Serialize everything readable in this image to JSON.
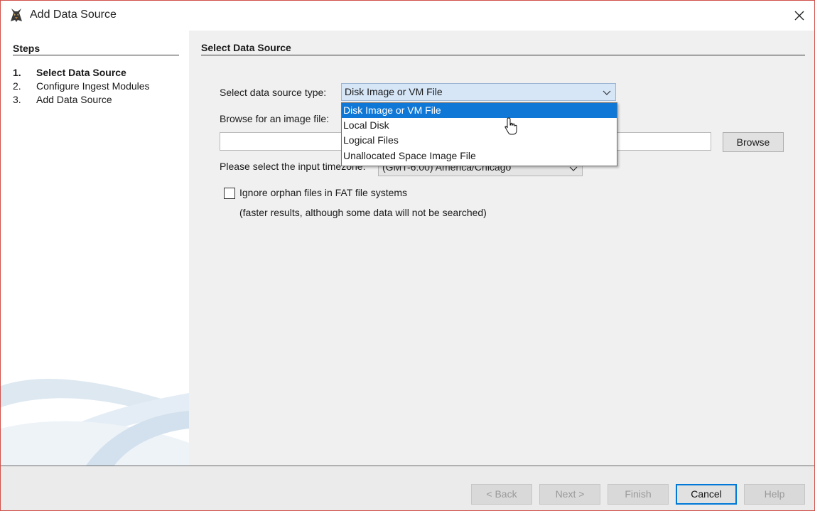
{
  "window": {
    "title": "Add Data Source",
    "icons": {
      "app": "autopsy-dog-icon",
      "close": "close-icon"
    }
  },
  "steps": {
    "title": "Steps",
    "items": [
      {
        "num": "1.",
        "label": "Select Data Source",
        "current": true
      },
      {
        "num": "2.",
        "label": "Configure Ingest Modules",
        "current": false
      },
      {
        "num": "3.",
        "label": "Add Data Source",
        "current": false
      }
    ]
  },
  "main": {
    "title": "Select Data Source",
    "source_type_label": "Select data source type:",
    "source_type_value": "Disk Image or VM File",
    "browse_label": "Browse for an image file:",
    "path_value": "",
    "browse_button": "Browse",
    "timezone_label": "Please select the input timezone:",
    "timezone_value": "(GMT-6:00) America/Chicago",
    "orphan_checkbox_label": "Ignore orphan files in FAT file systems",
    "orphan_checkbox_checked": false,
    "orphan_note": "(faster results, although some data will not be searched)"
  },
  "dropdown": {
    "open": true,
    "options": [
      {
        "label": "Disk Image or VM File",
        "selected": true
      },
      {
        "label": "Local Disk",
        "selected": false
      },
      {
        "label": "Logical Files",
        "selected": false
      },
      {
        "label": "Unallocated Space Image File",
        "selected": false
      }
    ]
  },
  "footer": {
    "back": {
      "label": "< Back",
      "enabled": false
    },
    "next": {
      "label": "Next >",
      "enabled": false
    },
    "finish": {
      "label": "Finish",
      "enabled": false
    },
    "cancel": {
      "label": "Cancel",
      "enabled": true
    },
    "help": {
      "label": "Help",
      "enabled": false
    }
  },
  "colors": {
    "selection": "#0f78d7",
    "combo_bg": "#d6e6f7",
    "window_border": "#d0504a"
  }
}
